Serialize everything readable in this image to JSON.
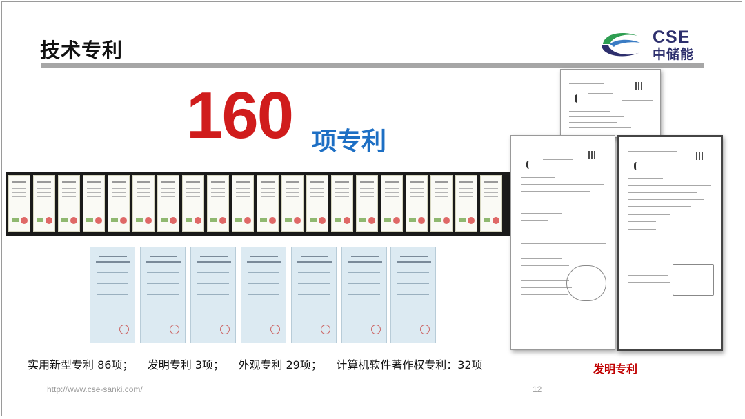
{
  "slide": {
    "title": "技术专利",
    "logo": {
      "en": "CSE",
      "cn": "中储能",
      "colors": {
        "blue": "#2d2f6d",
        "green": "#2e9e52",
        "light_blue": "#3a7cc4"
      }
    },
    "headline": {
      "number": "160",
      "unit": "项专利",
      "number_color": "#d01c1c",
      "unit_color": "#1d6fc4"
    },
    "caption": "实用新型专利 86项；    发明专利 3项；    外观专利 29项；    计算机软件著作权专利：32项",
    "invention_label": "发明专利",
    "footer": {
      "url": "http://www.cse-sanki.com/",
      "page": "12"
    }
  }
}
